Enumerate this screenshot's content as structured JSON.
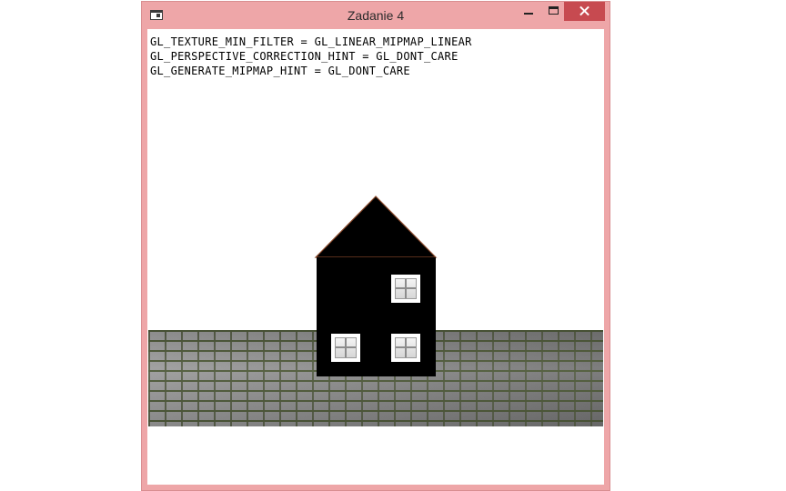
{
  "window": {
    "title": "Zadanie 4"
  },
  "gl_info": {
    "lines": [
      "GL_TEXTURE_MIN_FILTER = GL_LINEAR_MIPMAP_LINEAR",
      "GL_PERSPECTIVE_CORRECTION_HINT = GL_DONT_CARE",
      "GL_GENERATE_MIPMAP_HINT = GL_DONT_CARE"
    ]
  },
  "icons": {
    "app": "app-window-icon",
    "minimize": "minimize-icon",
    "maximize": "maximize-icon",
    "close": "close-icon"
  },
  "colors": {
    "frame": "#eea6a8",
    "close_button": "#c74a50",
    "roof_edge": "#8b4a2b",
    "house": "#000000"
  }
}
